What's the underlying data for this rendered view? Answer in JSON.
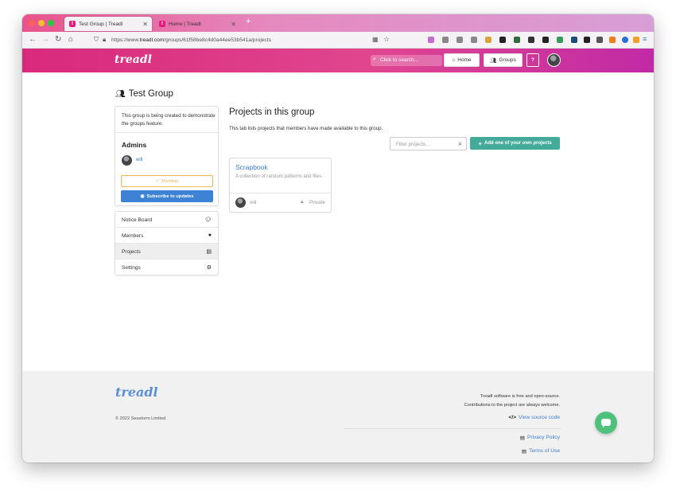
{
  "browser": {
    "tabs": [
      {
        "title": "Test Group | Treadl"
      },
      {
        "title": "Home | Treadl"
      }
    ],
    "new_tab": "+",
    "url_prefix": "https://www.",
    "url_host": "treadl.com",
    "url_path": "/groups/61f58be8c4d0a44ee53b541a/projects"
  },
  "header": {
    "logo": "treadl",
    "search_placeholder": "Click to search...",
    "home_label": "Home",
    "groups_label": "Groups",
    "help_label": "?"
  },
  "group": {
    "title": "Test Group",
    "description": "This group is being created to demonstrate the groups feature.",
    "admins_heading": "Admins",
    "admin_name": "will",
    "member_label": "Member",
    "subscribe_label": "Subscribe to updates",
    "menu": [
      {
        "label": "Notice Board",
        "icon": "comment-icon"
      },
      {
        "label": "Members",
        "icon": "user-icon"
      },
      {
        "label": "Projects",
        "icon": "book-icon"
      },
      {
        "label": "Settings",
        "icon": "gears-icon"
      }
    ]
  },
  "projects": {
    "heading": "Projects in this group",
    "subtitle": "This tab lists projects that members have made available to this group.",
    "filter_placeholder": "Filter projects...",
    "add_label": "Add one of your own projects",
    "items": [
      {
        "name": "Scrapbook",
        "description": "A collection of random patterns and files.",
        "owner": "will",
        "visibility": "Private"
      }
    ]
  },
  "footer": {
    "logo": "treadl",
    "copyright": "© 2022 Seastorm Limited",
    "line1": "Treadl software is free and open-source.",
    "line2": "Contributions to the project are always welcome.",
    "source_link": "View source code",
    "privacy_link": "Privacy Policy",
    "terms_link": "Terms of Use"
  },
  "colors": {
    "brand_pink": "#e0468e",
    "teal": "#44aa9a",
    "blue": "#3e82d6",
    "member_orange": "#f0b55a",
    "chat_green": "#4ec27a"
  }
}
